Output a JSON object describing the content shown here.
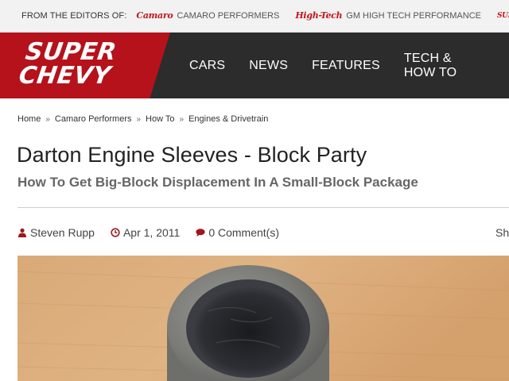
{
  "editors_bar": {
    "label": "FROM THE EDITORS OF:",
    "sites": [
      {
        "logo": "Camaro",
        "name": "CAMARO PERFORMERS"
      },
      {
        "logo": "High-Tech",
        "name": "GM HIGH TECH PERFORMANCE"
      },
      {
        "logo": "SUPER CHEVY",
        "name": ""
      }
    ]
  },
  "header": {
    "brand_line1": "SUPER",
    "brand_line2": "CHEVY",
    "nav": [
      "CARS",
      "NEWS",
      "FEATURES",
      "TECH & HOW TO"
    ]
  },
  "breadcrumb": [
    "Home",
    "Camaro Performers",
    "How To",
    "Engines & Drivetrain"
  ],
  "article": {
    "title": "Darton Engine Sleeves - Block Party",
    "subtitle": "How To Get Big-Block Displacement In A Small-Block Package",
    "author": "Steven Rupp",
    "date": "Apr 1, 2011",
    "comments": "0 Comment(s)",
    "share": "Sh"
  },
  "icons": {
    "author": "user-icon",
    "date": "clock-icon",
    "comments": "comment-icon"
  },
  "colors": {
    "brand_red": "#b5121b",
    "header_dark": "#2c2c2c",
    "icon_red": "#a0161d"
  }
}
